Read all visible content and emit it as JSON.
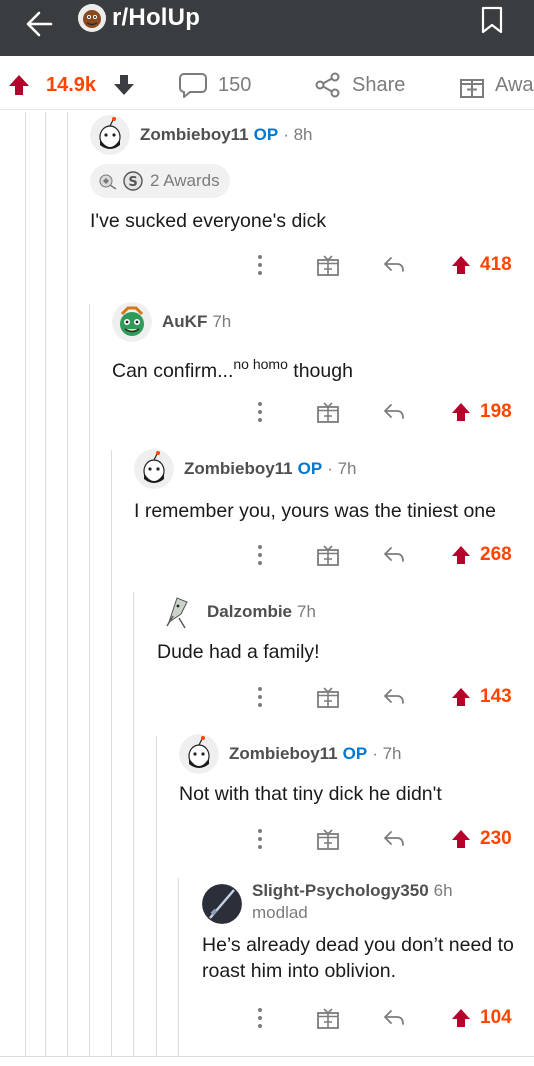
{
  "header": {
    "subreddit": "r/HolUp"
  },
  "post_actions": {
    "score": "14.9k",
    "comments": "150",
    "share": "Share",
    "award": "Awa"
  },
  "comments": [
    {
      "user": "Zombieboy11",
      "op": "OP",
      "time": "· 8h",
      "awards": "2 Awards",
      "body": "I've sucked everyone's dick",
      "votes": "418"
    },
    {
      "user": "AuKF",
      "time": "7h",
      "body_main": "Can confirm...",
      "body_sup": "no homo",
      "body_end": " though",
      "votes": "198"
    },
    {
      "user": "Zombieboy11",
      "op": "OP",
      "time": "· 7h",
      "body": "I remember you, yours was the tiniest one",
      "votes": "268"
    },
    {
      "user": "Dalzombie",
      "time": "7h",
      "body": "Dude had a family!",
      "votes": "143"
    },
    {
      "user": "Zombieboy11",
      "op": "OP",
      "time": "· 7h",
      "body": "Not with that tiny dick he didn't",
      "votes": "230"
    },
    {
      "user": "Slight-Psychology350",
      "time": "6h",
      "flair": "modlad",
      "body_line1": "He’s already dead you don’t need to",
      "body_line2": "roast him into oblivion.",
      "votes": "104"
    }
  ],
  "colors": {
    "topbar": "#3a3d40",
    "upvote": "#ff4500",
    "op_blue": "#0079d3",
    "upvote_arrow": "#b4002b"
  }
}
